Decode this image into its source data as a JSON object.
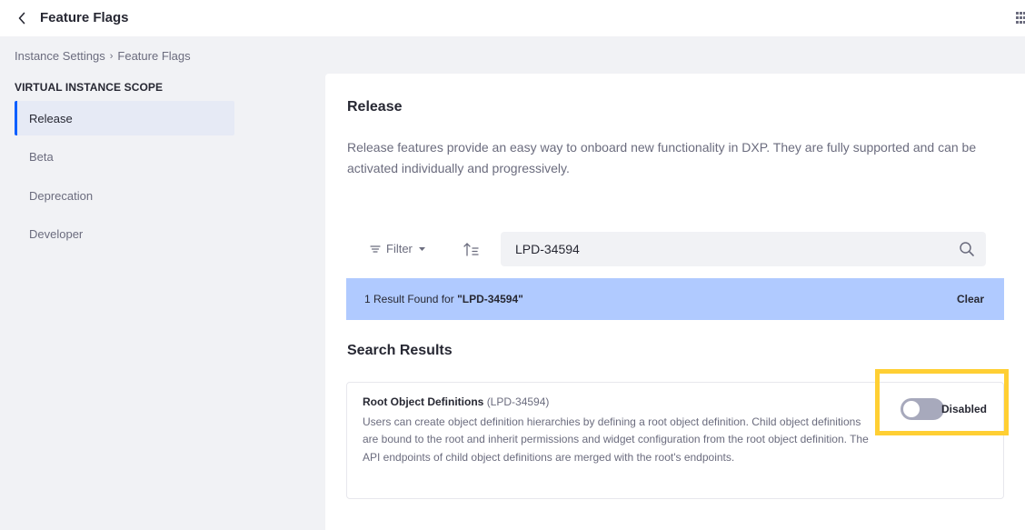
{
  "header": {
    "title": "Feature Flags",
    "back_icon": "chevron-left-icon",
    "apps_icon": "grid-icon"
  },
  "breadcrumb": {
    "items": [
      "Instance Settings",
      "Feature Flags"
    ],
    "separator": "›"
  },
  "sidebar": {
    "scope_label": "VIRTUAL INSTANCE SCOPE",
    "items": [
      {
        "label": "Release",
        "active": true
      },
      {
        "label": "Beta"
      },
      {
        "label": "Deprecation"
      },
      {
        "label": "Developer"
      }
    ]
  },
  "main": {
    "title": "Release",
    "description": "Release features provide an easy way to onboard new functionality in DXP. They are fully supported and can be activated individually and progressively.",
    "toolbar": {
      "filter_label": "Filter",
      "search_value": "LPD-34594"
    },
    "result_bar": {
      "prefix": "1 Result Found for ",
      "query": "\"LPD-34594\"",
      "clear_label": "Clear"
    },
    "results_title": "Search Results",
    "results": [
      {
        "name": "Root Object Definitions",
        "key": "(LPD-34594)",
        "description": "Users can create object definition hierarchies by defining a root object definition. Child object definitions are bound to the root and inherit permissions and widget configuration from the root object definition. The API endpoints of child object definitions are merged with the root's endpoints.",
        "toggle_label": "Disabled",
        "enabled": false
      }
    ]
  },
  "colors": {
    "accent": "#0b5fff",
    "result_bar": "#b0caff",
    "highlight": "#ffcf33",
    "toggle_off": "#a7a9bc"
  }
}
